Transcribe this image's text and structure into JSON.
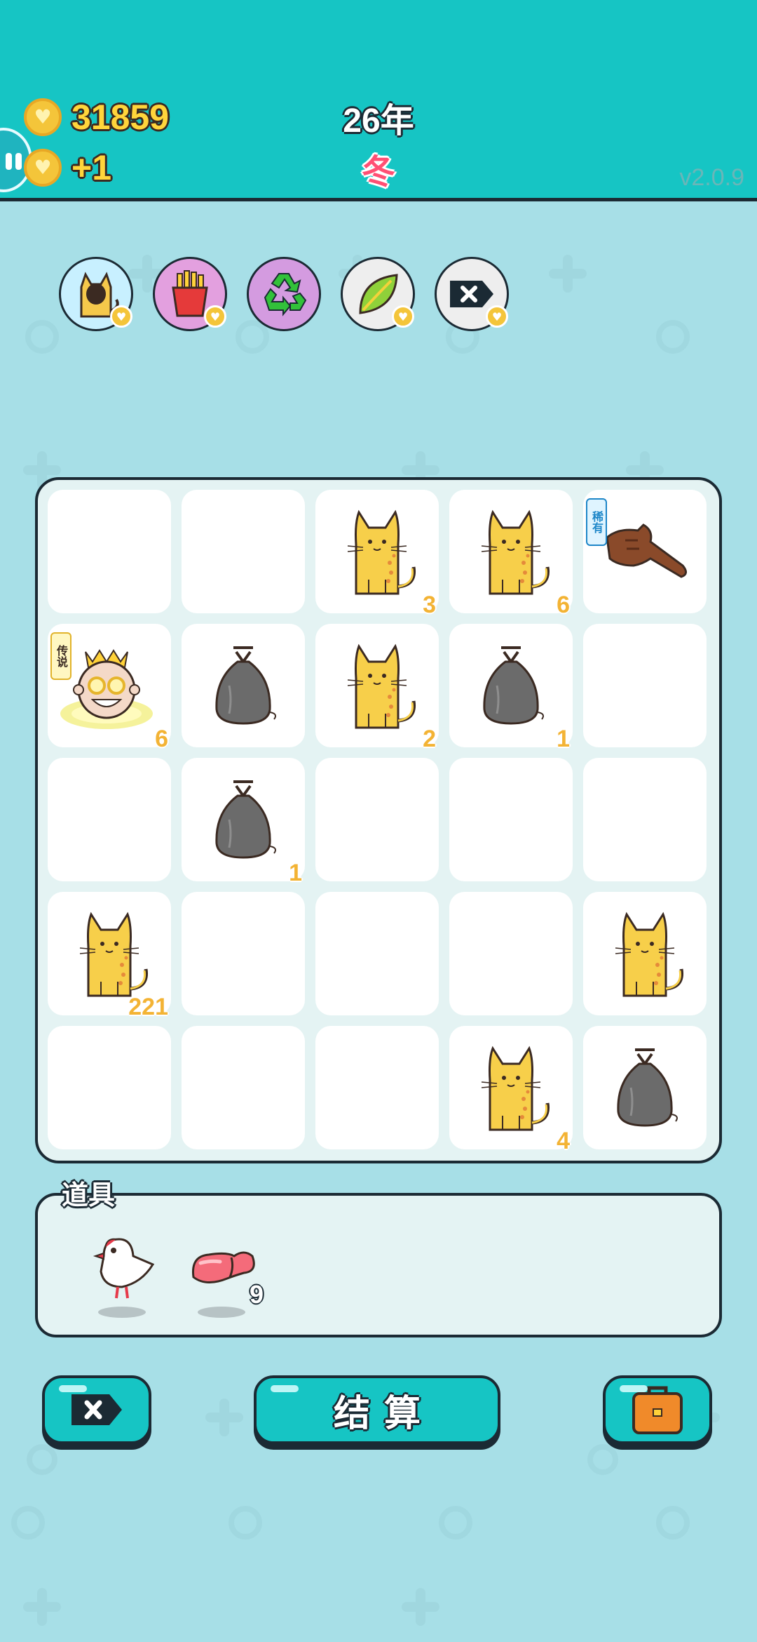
{
  "header": {
    "coins": "31859",
    "income": "+1",
    "year": "26年",
    "season": "冬",
    "version": "v2.0.9"
  },
  "skills": [
    {
      "icon": "cat-eat-icon",
      "color": "#c8f0ff"
    },
    {
      "icon": "fries-icon",
      "color": "#e3a0df"
    },
    {
      "icon": "recycle-icon",
      "color": "#d49be0"
    },
    {
      "icon": "leaf-icon",
      "color": "#eeeeee"
    },
    {
      "icon": "delete-tag-icon",
      "color": "#eeeeee"
    }
  ],
  "board": {
    "rows": [
      [
        {
          "item": "empty"
        },
        {
          "item": "empty"
        },
        {
          "item": "cat",
          "count": "3"
        },
        {
          "item": "cat",
          "count": "6"
        },
        {
          "item": "pointing-hand",
          "tag": "稀有"
        }
      ],
      [
        {
          "item": "king",
          "count": "6",
          "tag": "传说"
        },
        {
          "item": "garbage-bag"
        },
        {
          "item": "cat",
          "count": "2"
        },
        {
          "item": "garbage-bag",
          "count": "1"
        },
        {
          "item": "empty"
        }
      ],
      [
        {
          "item": "empty"
        },
        {
          "item": "garbage-bag",
          "count": "1"
        },
        {
          "item": "empty"
        },
        {
          "item": "empty"
        },
        {
          "item": "empty"
        }
      ],
      [
        {
          "item": "cat",
          "count": "221"
        },
        {
          "item": "empty"
        },
        {
          "item": "empty"
        },
        {
          "item": "empty"
        },
        {
          "item": "cat"
        }
      ],
      [
        {
          "item": "empty"
        },
        {
          "item": "empty"
        },
        {
          "item": "empty"
        },
        {
          "item": "cat",
          "count": "4"
        },
        {
          "item": "garbage-bag"
        }
      ]
    ]
  },
  "items_panel": {
    "title": "道具",
    "tools": [
      {
        "icon": "bird-icon"
      },
      {
        "icon": "meat-icon",
        "count": "9"
      }
    ]
  },
  "buttons": {
    "settle_label": "结算"
  }
}
